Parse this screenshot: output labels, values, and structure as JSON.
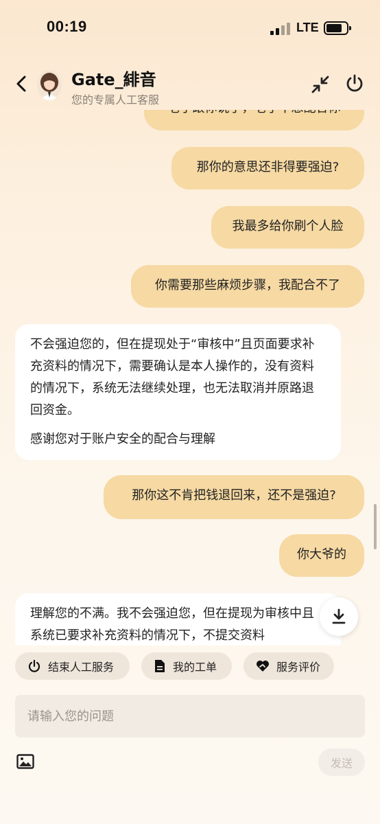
{
  "status_bar": {
    "time": "00:19",
    "network": "LTE"
  },
  "header": {
    "title": "Gate_緋音",
    "subtitle": "您的专属人工客服",
    "icons": [
      "back-arrow-icon",
      "minimize-icon",
      "power-icon"
    ]
  },
  "messages": [
    {
      "sender": "user",
      "text": "老子跟你说了，老子不想配合你"
    },
    {
      "sender": "user",
      "text": "那你的意思还非得要强迫?"
    },
    {
      "sender": "user",
      "text": "我最多给你刷个人脸"
    },
    {
      "sender": "user",
      "text": "你需要那些麻烦步骤，我配合不了"
    },
    {
      "sender": "agent",
      "paragraphs": [
        "不会强迫您的，但在提现处于“审核中”且页面要求补充资料的情况下，需要确认是本人操作的，没有资料的情况下，系统无法继续处理，也无法取消并原路退回资金。",
        "感谢您对于账户安全的配合与理解"
      ]
    },
    {
      "sender": "user",
      "text": "那你这不肯把钱退回来，还不是强迫?"
    },
    {
      "sender": "user",
      "text": "你大爷的"
    },
    {
      "sender": "agent",
      "paragraphs": [
        "理解您的不满。我不会强迫您，但在提现为审核中且系统已要求补充资料的情况下，不提交资料"
      ]
    }
  ],
  "quick_actions": [
    {
      "label": "结束人工服务",
      "icon": "power-icon"
    },
    {
      "label": "我的工单",
      "icon": "document-icon"
    },
    {
      "label": "服务评价",
      "icon": "heart-hand-icon"
    }
  ],
  "composer": {
    "placeholder": "请输入您的问题",
    "send_label": "发送",
    "image_icon": "image-icon"
  },
  "colors": {
    "user_bubble": "#f6d9a3",
    "agent_bubble": "#ffffff",
    "pill_bg": "#efe6db"
  }
}
